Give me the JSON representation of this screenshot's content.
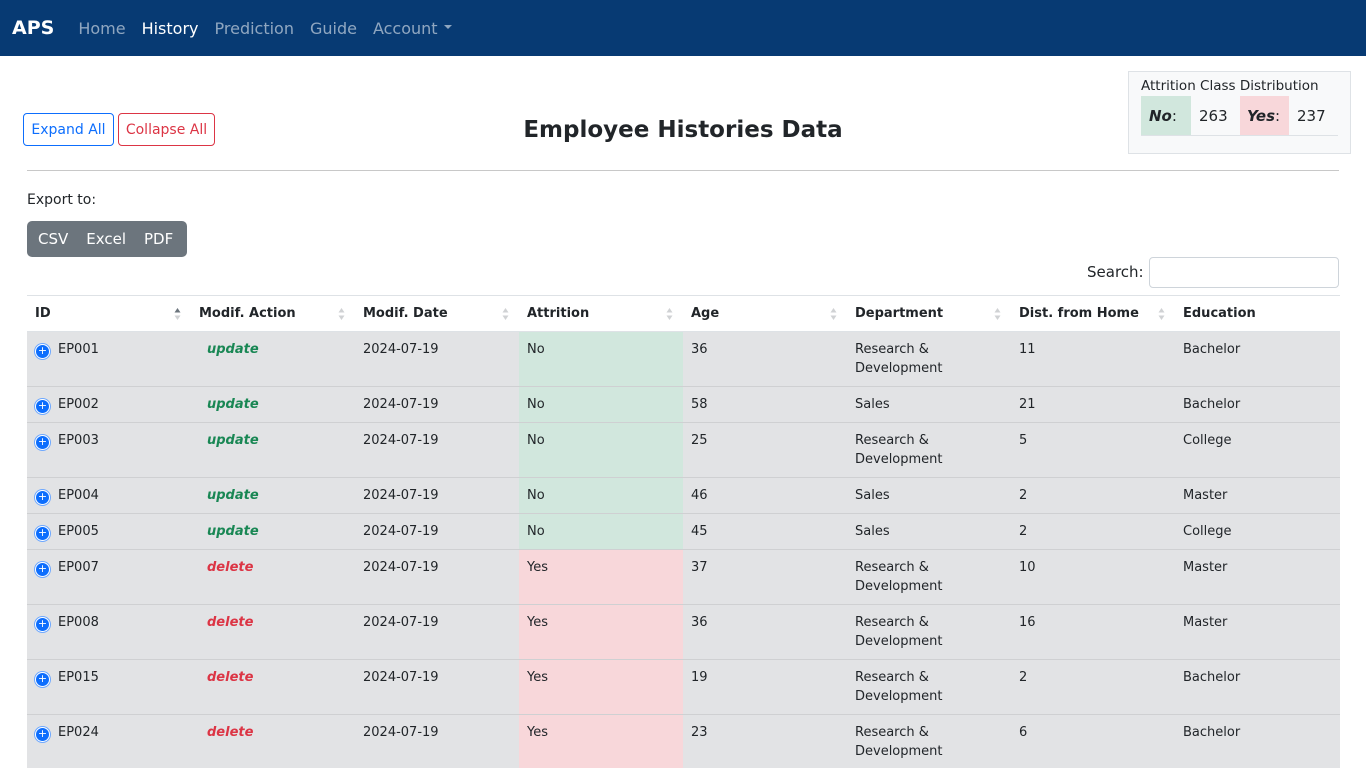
{
  "nav": {
    "brand": "APS",
    "links": [
      "Home",
      "History",
      "Prediction",
      "Guide",
      "Account"
    ]
  },
  "toolbar": {
    "expand_label": "Expand All",
    "collapse_label": "Collapse All"
  },
  "title": "Employee Histories Data",
  "distribution": {
    "title": "Attrition Class Distribution",
    "no_label": "No",
    "no_value": "263",
    "yes_label": "Yes",
    "yes_value": "237"
  },
  "export": {
    "label": "Export to:",
    "buttons": [
      "CSV",
      "Excel",
      "PDF"
    ]
  },
  "search": {
    "label": "Search:",
    "value": ""
  },
  "table": {
    "headers": [
      "ID",
      "Modif. Action",
      "Modif. Date",
      "Attrition",
      "Age",
      "Department",
      "Dist. from Home",
      "Education"
    ],
    "rows": [
      [
        "EP001",
        "update",
        "2024-07-19",
        "No",
        "36",
        "Research & Development",
        "11",
        "Bachelor"
      ],
      [
        "EP002",
        "update",
        "2024-07-19",
        "No",
        "58",
        "Sales",
        "21",
        "Bachelor"
      ],
      [
        "EP003",
        "update",
        "2024-07-19",
        "No",
        "25",
        "Research & Development",
        "5",
        "College"
      ],
      [
        "EP004",
        "update",
        "2024-07-19",
        "No",
        "46",
        "Sales",
        "2",
        "Master"
      ],
      [
        "EP005",
        "update",
        "2024-07-19",
        "No",
        "45",
        "Sales",
        "2",
        "College"
      ],
      [
        "EP007",
        "delete",
        "2024-07-19",
        "Yes",
        "37",
        "Research & Development",
        "10",
        "Master"
      ],
      [
        "EP008",
        "delete",
        "2024-07-19",
        "Yes",
        "36",
        "Research & Development",
        "16",
        "Master"
      ],
      [
        "EP015",
        "delete",
        "2024-07-19",
        "Yes",
        "19",
        "Research & Development",
        "2",
        "Bachelor"
      ],
      [
        "EP024",
        "delete",
        "2024-07-19",
        "Yes",
        "23",
        "Research & Development",
        "6",
        "Bachelor"
      ]
    ]
  },
  "colors": {
    "navbar": "#073a73",
    "attrition_no": "#d1e7dd",
    "attrition_yes": "#f8d7da",
    "update": "#198754",
    "delete": "#dc3545"
  }
}
